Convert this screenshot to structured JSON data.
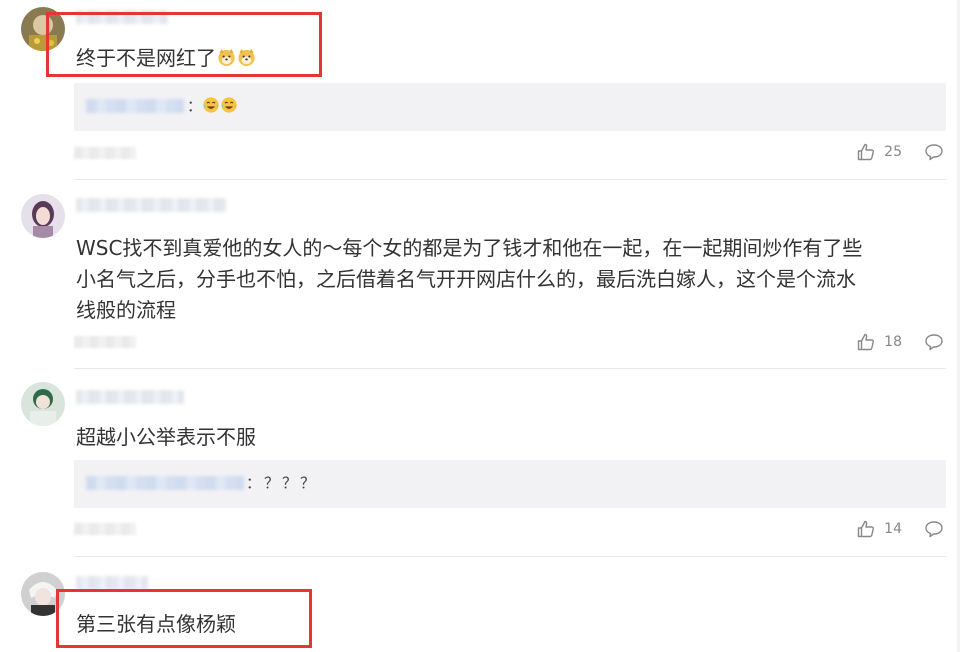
{
  "comments": [
    {
      "text": "终于不是网红了",
      "emojis": [
        "doge-icon",
        "doge-icon"
      ],
      "reply": {
        "text": "：",
        "emojis": [
          "laughing-crying-icon",
          "laughing-crying-icon"
        ]
      },
      "likes": "25"
    },
    {
      "text_lines": [
        "WSC找不到真爱他的女人的～每个女的都是为了钱才和他在一起，在一起期间炒作有了些",
        "小名气之后，分手也不怕，之后借着名气开开网店什么的，最后洗白嫁人，这个是个流水",
        "线般的流程"
      ],
      "likes": "18"
    },
    {
      "text": "超越小公举表示不服",
      "reply": {
        "text": "：？？？"
      },
      "likes": "14"
    },
    {
      "text": "第三张有点像杨颖"
    }
  ],
  "colors": {
    "highlight": "#e63535",
    "reply_bg": "#f2f2f5",
    "icon_gray": "#888888"
  }
}
